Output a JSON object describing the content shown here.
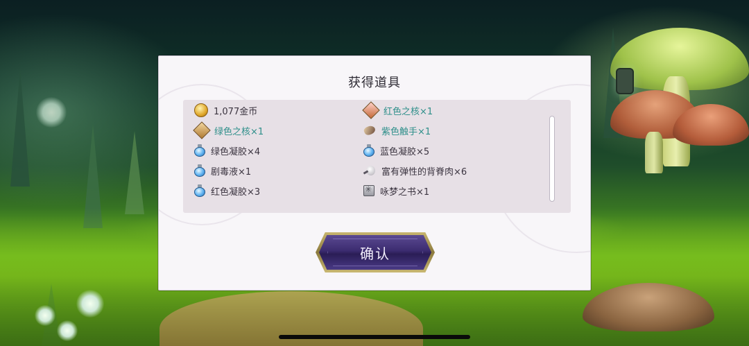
{
  "dialog": {
    "title": "获得道具",
    "items": [
      {
        "label": "1,077金币",
        "icon": "coin-icon"
      },
      {
        "label": "红色之核×1",
        "icon": "red-core-icon"
      },
      {
        "label": "绿色之核×1",
        "icon": "green-core-icon"
      },
      {
        "label": "紫色触手×1",
        "icon": "tentacle-icon"
      },
      {
        "label": "绿色凝胶×4",
        "icon": "potion-icon"
      },
      {
        "label": "蓝色凝胶×5",
        "icon": "potion-icon"
      },
      {
        "label": "剧毒液×1",
        "icon": "potion-icon"
      },
      {
        "label": "富有弹性的背脊肉×6",
        "icon": "meat-icon"
      },
      {
        "label": "红色凝胶×3",
        "icon": "potion-icon"
      },
      {
        "label": "咏梦之书×1",
        "icon": "book-icon"
      }
    ],
    "confirm_label": "确认"
  },
  "colors": {
    "highlight_text": "#2e8f8a",
    "normal_text": "#3b3440",
    "button_fill": "#3c2c70",
    "button_border": "#c7b56f"
  }
}
